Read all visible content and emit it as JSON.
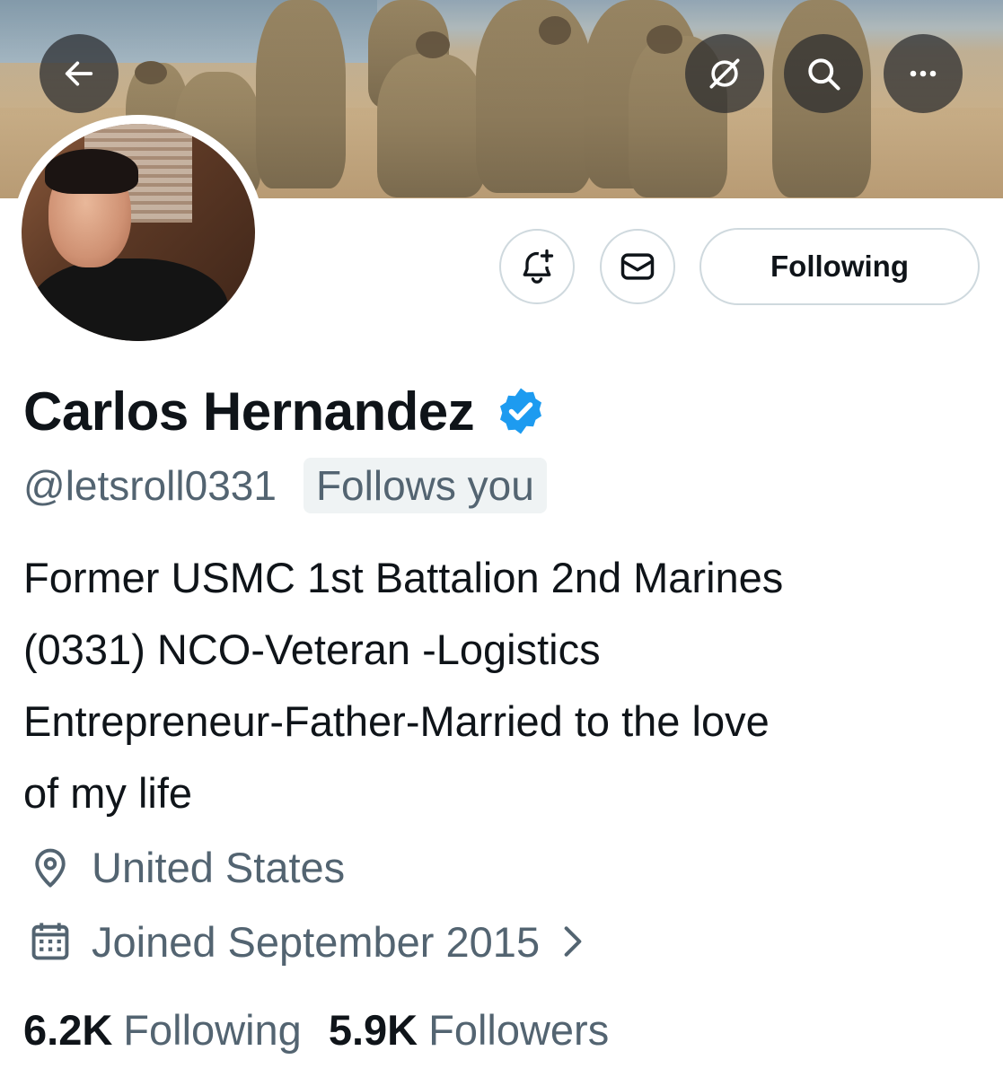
{
  "header": {
    "back_icon": "arrow-left-icon",
    "translate_icon": "slashed-circle-icon",
    "search_icon": "search-icon",
    "more_icon": "more-horizontal-icon"
  },
  "actions": {
    "notify_icon": "bell-plus-icon",
    "message_icon": "envelope-icon",
    "following_label": "Following"
  },
  "profile": {
    "name": "Carlos Hernandez",
    "verified_icon": "verified-badge-icon",
    "handle": "@letsroll0331",
    "follows_you": "Follows you",
    "bio_lines": [
      "Former USMC 1st Battalion 2nd Marines",
      "(0331) NCO-Veteran -Logistics",
      "Entrepreneur-Father-Married to the love",
      "of my life"
    ],
    "location": "United States",
    "joined": "Joined September 2015"
  },
  "stats": {
    "following_count": "6.2K",
    "following_label": "Following",
    "followers_count": "5.9K",
    "followers_label": "Followers"
  },
  "colors": {
    "verified": "#1d9bf0",
    "secondary_text": "#536471",
    "border": "#cfd9de"
  }
}
